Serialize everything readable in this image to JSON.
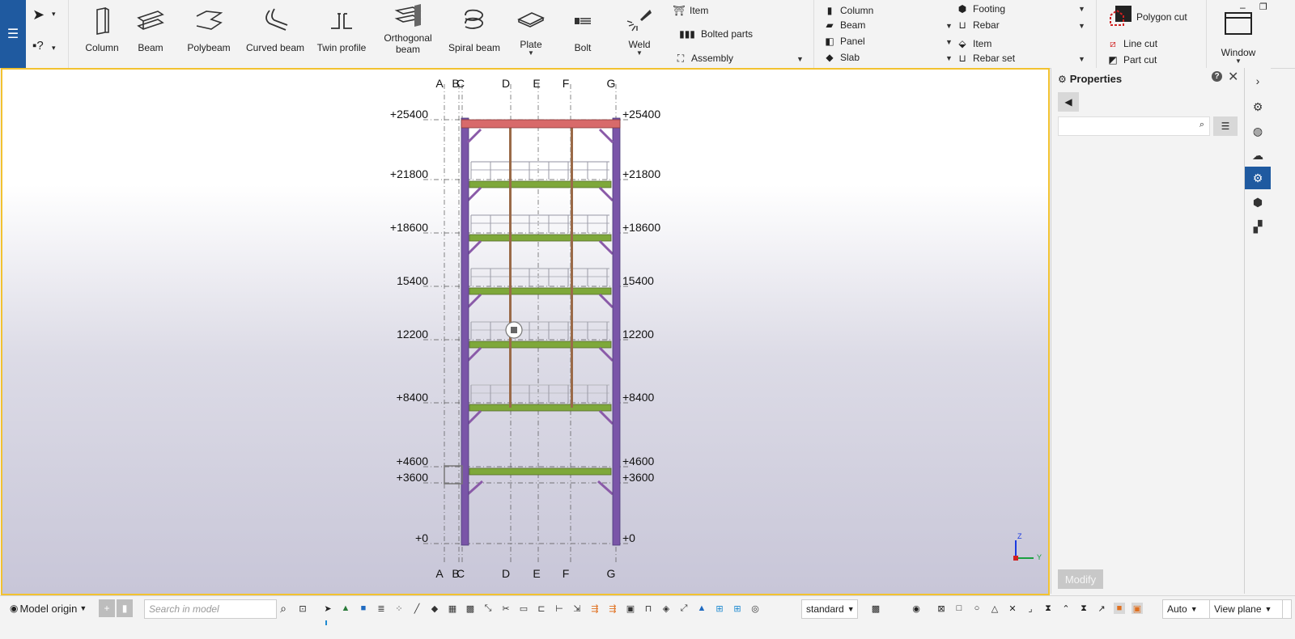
{
  "ribbon": {
    "app_menu_icon": "hamburger-icon",
    "tools": [
      {
        "label": "Column",
        "icon": "column-icon"
      },
      {
        "label": "Beam",
        "icon": "beam-icon"
      },
      {
        "label": "Polybeam",
        "icon": "polybeam-icon"
      },
      {
        "label": "Curved beam",
        "icon": "curved-beam-icon"
      },
      {
        "label": "Twin profile",
        "icon": "twin-profile-icon"
      },
      {
        "label": "Orthogonal beam",
        "icon": "orthogonal-beam-icon"
      },
      {
        "label": "Spiral beam",
        "icon": "spiral-beam-icon"
      },
      {
        "label": "Plate",
        "icon": "plate-icon"
      },
      {
        "label": "Bolt",
        "icon": "bolt-icon"
      },
      {
        "label": "Weld",
        "icon": "weld-icon"
      }
    ],
    "detail_group": {
      "item": "Item",
      "bolted_parts": "Bolted parts",
      "assembly": "Assembly"
    },
    "concrete_group": {
      "column": "Column",
      "beam": "Beam",
      "panel": "Panel",
      "slab": "Slab"
    },
    "rebar_group": {
      "footing": "Footing",
      "rebar": "Rebar",
      "item": "Item",
      "rebar_set": "Rebar set"
    },
    "cut_group": {
      "polygon_cut": "Polygon cut",
      "line_cut": "Line cut",
      "part_cut": "Part cut"
    },
    "window": {
      "label": "Window"
    }
  },
  "viewport": {
    "grid_x": [
      "A",
      "B",
      "C",
      "D",
      "E",
      "F",
      "G"
    ],
    "levels_left": [
      "+25400",
      "+21800",
      "+18600",
      "15400",
      "12200",
      "+8400",
      "+4600",
      "+3600",
      "+0"
    ],
    "levels_right": [
      "+25400",
      "+21800",
      "+18600",
      "15400",
      "12200",
      "+8400",
      "+4600",
      "+3600",
      "+0"
    ],
    "axis_z": "Z",
    "axis_y": "Y",
    "colors": {
      "column": "#7a55a8",
      "beam": "#7ea83a",
      "roof_beam": "#d86a6a",
      "inner_column": "#9a6a48",
      "railing": "#c8c8d0",
      "brace": "#8a5aa8"
    }
  },
  "properties": {
    "title": "Properties",
    "modify": "Modify"
  },
  "status": {
    "model_origin": "Model origin",
    "search_placeholder": "Search in model",
    "standard": "standard",
    "auto": "Auto",
    "view_plane": "View plane"
  }
}
